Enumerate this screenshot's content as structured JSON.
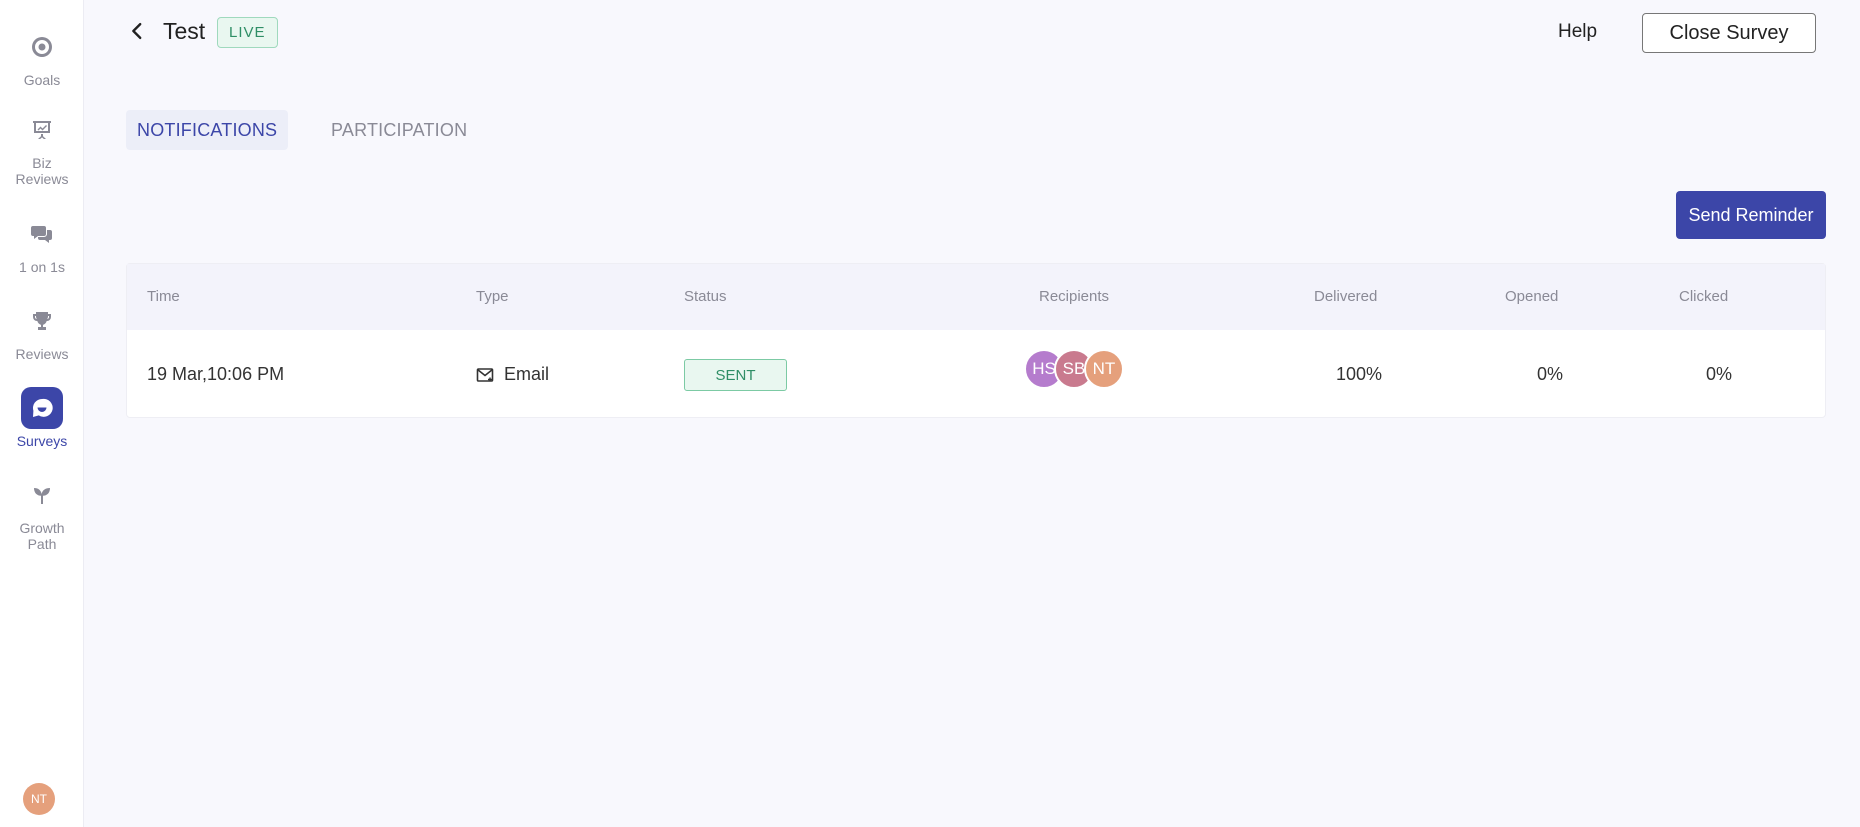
{
  "sidebar": {
    "items": [
      {
        "label": "Goals",
        "icon": "target-icon"
      },
      {
        "label": "Biz Reviews",
        "icon": "presentation-icon"
      },
      {
        "label": "1 on 1s",
        "icon": "chat-bubbles-icon"
      },
      {
        "label": "Reviews",
        "icon": "trophy-icon"
      },
      {
        "label": "Surveys",
        "icon": "survey-bubble-icon"
      },
      {
        "label": "Growth Path",
        "icon": "sprout-icon"
      }
    ],
    "active": "Surveys",
    "user_initials": "NT"
  },
  "header": {
    "title": "Test",
    "badge": "LIVE",
    "help": "Help",
    "close_button": "Close Survey"
  },
  "tabs": {
    "notifications": "NOTIFICATIONS",
    "participation": "PARTICIPATION",
    "active": "NOTIFICATIONS"
  },
  "actions": {
    "send_reminder": "Send Reminder"
  },
  "table": {
    "columns": {
      "time": "Time",
      "type": "Type",
      "status": "Status",
      "recipients": "Recipients",
      "delivered": "Delivered",
      "opened": "Opened",
      "clicked": "Clicked"
    },
    "rows": [
      {
        "time": "19 Mar,10:06 PM",
        "type": "Email",
        "status": "SENT",
        "recipients": [
          {
            "initials": "HS",
            "color": "#b57ccd"
          },
          {
            "initials": "SB",
            "color": "#c97a8e"
          },
          {
            "initials": "NT",
            "color": "#e5a07c"
          }
        ],
        "delivered": "100%",
        "opened": "0%",
        "clicked": "0%"
      }
    ]
  },
  "colors": {
    "accent": "#3c46a8",
    "success": "#2f8e66",
    "background": "#f8f8fd"
  }
}
